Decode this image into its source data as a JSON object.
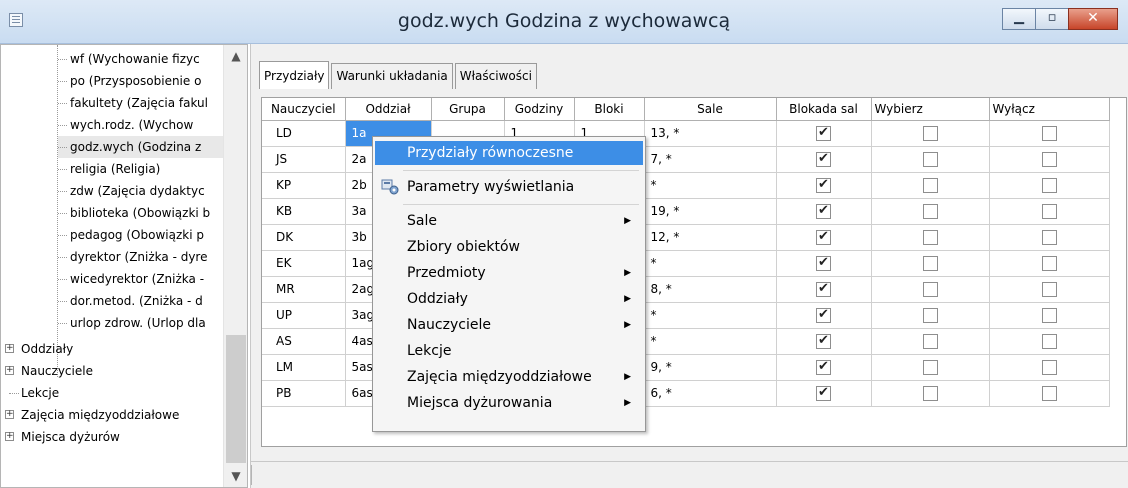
{
  "window": {
    "title": "godz.wych Godzina z wychowawcą"
  },
  "tree": {
    "children": [
      "wf (Wychowanie fizyc",
      "po (Przysposobienie o",
      "fakultety (Zajęcia fakul",
      "wych.rodz. (Wychow",
      "godz.wych (Godzina z",
      "religia (Religia)",
      "zdw (Zajęcia dydaktyc",
      "biblioteka (Obowiązki b",
      "pedagog (Obowiązki p",
      "dyrektor (Zniżka - dyre",
      "wicedyrektor (Zniżka -",
      "dor.metod. (Zniżka - d",
      "urlop zdrow. (Urlop dla"
    ],
    "top_level": [
      {
        "label": "Oddziały",
        "expandable": true
      },
      {
        "label": "Nauczyciele",
        "expandable": true
      },
      {
        "label": "Lekcje",
        "expandable": false
      },
      {
        "label": "Zajęcia międzyoddziałowe",
        "expandable": true
      },
      {
        "label": "Miejsca dyżurów",
        "expandable": true
      }
    ],
    "expander_glyph": "+"
  },
  "tabs": [
    "Przydziały",
    "Warunki układania",
    "Właściwości"
  ],
  "grid": {
    "columns": [
      "Nauczyciel",
      "Oddział",
      "Grupa",
      "Godziny",
      "Bloki",
      "Sale",
      "Blokada sal",
      "Wybierz",
      "Wyłącz"
    ],
    "rows": [
      {
        "nauczyciel": "LD",
        "oddzial": "1a",
        "grupa": "",
        "godziny": "1",
        "bloki": "1",
        "sale": "13, *",
        "blokada": true,
        "wybierz": false,
        "wylacz": false
      },
      {
        "nauczyciel": "JS",
        "oddzial": "2a",
        "grupa": "",
        "godziny": "",
        "bloki": "",
        "sale": "7, *",
        "blokada": true,
        "wybierz": false,
        "wylacz": false
      },
      {
        "nauczyciel": "KP",
        "oddzial": "2b",
        "grupa": "",
        "godziny": "",
        "bloki": "",
        "sale": "*",
        "blokada": true,
        "wybierz": false,
        "wylacz": false
      },
      {
        "nauczyciel": "KB",
        "oddzial": "3a",
        "grupa": "",
        "godziny": "",
        "bloki": "",
        "sale": "19, *",
        "blokada": true,
        "wybierz": false,
        "wylacz": false
      },
      {
        "nauczyciel": "DK",
        "oddzial": "3b",
        "grupa": "",
        "godziny": "",
        "bloki": "",
        "sale": "12, *",
        "blokada": true,
        "wybierz": false,
        "wylacz": false
      },
      {
        "nauczyciel": "EK",
        "oddzial": "1ag",
        "grupa": "",
        "godziny": "",
        "bloki": "",
        "sale": "*",
        "blokada": true,
        "wybierz": false,
        "wylacz": false
      },
      {
        "nauczyciel": "MR",
        "oddzial": "2ag",
        "grupa": "",
        "godziny": "",
        "bloki": "",
        "sale": "8, *",
        "blokada": true,
        "wybierz": false,
        "wylacz": false
      },
      {
        "nauczyciel": "UP",
        "oddzial": "3ag",
        "grupa": "",
        "godziny": "",
        "bloki": "",
        "sale": "*",
        "blokada": true,
        "wybierz": false,
        "wylacz": false
      },
      {
        "nauczyciel": "AS",
        "oddzial": "4as",
        "grupa": "",
        "godziny": "",
        "bloki": "",
        "sale": "*",
        "blokada": true,
        "wybierz": false,
        "wylacz": false
      },
      {
        "nauczyciel": "LM",
        "oddzial": "5as",
        "grupa": "",
        "godziny": "",
        "bloki": "",
        "sale": "9, *",
        "blokada": true,
        "wybierz": false,
        "wylacz": false
      },
      {
        "nauczyciel": "PB",
        "oddzial": "6as",
        "grupa": "",
        "godziny": "",
        "bloki": "",
        "sale": "6, *",
        "blokada": true,
        "wybierz": false,
        "wylacz": false
      }
    ]
  },
  "context_menu": {
    "items": [
      {
        "label": "Przydziały równoczesne",
        "highlighted": true,
        "submenu": false,
        "icon": ""
      },
      {
        "separator": true
      },
      {
        "label": "Parametry wyświetlania",
        "highlighted": false,
        "submenu": false,
        "icon": "display-params-icon"
      },
      {
        "separator": true
      },
      {
        "label": "Sale",
        "submenu": true
      },
      {
        "label": "Zbiory obiektów",
        "submenu": false
      },
      {
        "label": "Przedmioty",
        "submenu": true
      },
      {
        "label": "Oddziały",
        "submenu": true
      },
      {
        "label": "Nauczyciele",
        "submenu": true
      },
      {
        "label": "Lekcje",
        "submenu": false
      },
      {
        "label": "Zajęcia międzyoddziałowe",
        "submenu": true
      },
      {
        "label": "Miejsca dyżurowania",
        "submenu": true
      }
    ]
  },
  "colors": {
    "selection": "#3d8ee6",
    "close_button": "#c7452a",
    "titlebar": "#d3e3f4"
  },
  "icons": {
    "app": "window-list-icon",
    "minimize": "minimize-icon",
    "maximize": "maximize-icon",
    "close": "close-icon",
    "submenu": "chevron-right-icon"
  }
}
